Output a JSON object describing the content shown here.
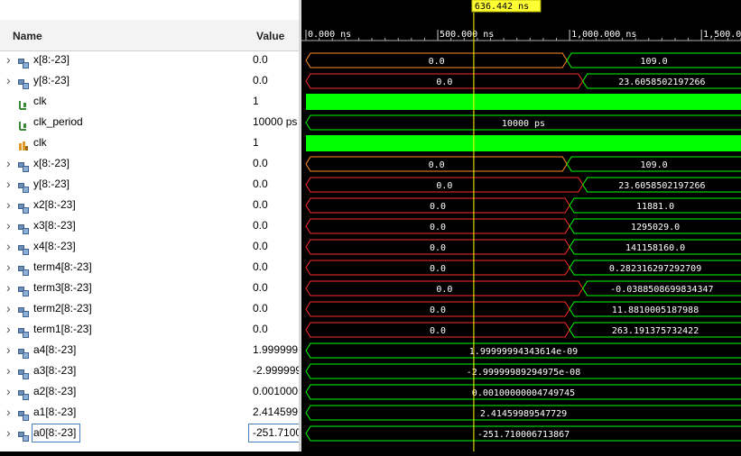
{
  "header": {
    "name_label": "Name",
    "value_label": "Value"
  },
  "cursor": {
    "label": "636.442 ns",
    "time_ns": 636.442
  },
  "timeline": {
    "visible_range_ns": [
      0,
      1650
    ],
    "ticks": [
      {
        "t": 0,
        "label": "0.000 ns"
      },
      {
        "t": 500,
        "label": "500.000 ns"
      },
      {
        "t": 1000,
        "label": "1,000.000 ns"
      },
      {
        "t": 1500,
        "label": "1,500.000 ns"
      }
    ]
  },
  "colors": {
    "clock": "#00ff00",
    "bus_initial": "#ff6a00",
    "bus_changed": "#00ff00",
    "bus_red": "#ff2a2a",
    "cursor": "#ffff00"
  },
  "signals": [
    {
      "name": "x[8:-23]",
      "icon": "bus-icon",
      "expandable": true,
      "value": "0.0",
      "kind": "bus",
      "stroke_before": "#ff8c2a",
      "segments": [
        {
          "t0": 0,
          "t1": 990,
          "text": "0.0"
        },
        {
          "t0": 990,
          "t1": 1650,
          "text": "109.0"
        }
      ]
    },
    {
      "name": "y[8:-23]",
      "icon": "bus-icon",
      "expandable": true,
      "value": "0.0",
      "kind": "bus",
      "stroke_before": "#ff2a2a",
      "segments": [
        {
          "t0": 0,
          "t1": 1050,
          "text": "0.0"
        },
        {
          "t0": 1050,
          "t1": 1650,
          "text": "23.6058502197266"
        }
      ]
    },
    {
      "name": "clk",
      "icon": "clock-bit-icon",
      "expandable": false,
      "value": "1",
      "kind": "clock"
    },
    {
      "name": "clk_period",
      "icon": "clock-bit-icon",
      "expandable": false,
      "value": "10000 ps",
      "kind": "const",
      "segments": [
        {
          "t0": 0,
          "t1": 1650,
          "text": "10000 ps"
        }
      ]
    },
    {
      "name": "clk",
      "icon": "clock-bit-orange-icon",
      "expandable": false,
      "value": "1",
      "kind": "clock"
    },
    {
      "name": "x[8:-23]",
      "icon": "bus-icon",
      "expandable": true,
      "value": "0.0",
      "kind": "bus",
      "stroke_before": "#ff8c2a",
      "segments": [
        {
          "t0": 0,
          "t1": 990,
          "text": "0.0"
        },
        {
          "t0": 990,
          "t1": 1650,
          "text": "109.0"
        }
      ]
    },
    {
      "name": "y[8:-23]",
      "icon": "bus-icon",
      "expandable": true,
      "value": "0.0",
      "kind": "bus",
      "stroke_before": "#ff2a2a",
      "segments": [
        {
          "t0": 0,
          "t1": 1050,
          "text": "0.0"
        },
        {
          "t0": 1050,
          "t1": 1650,
          "text": "23.6058502197266"
        }
      ]
    },
    {
      "name": "x2[8:-23]",
      "icon": "bus-icon",
      "expandable": true,
      "value": "0.0",
      "kind": "bus",
      "stroke_before": "#ff2a2a",
      "segments": [
        {
          "t0": 0,
          "t1": 1000,
          "text": "0.0"
        },
        {
          "t0": 1000,
          "t1": 1650,
          "text": "11881.0"
        }
      ]
    },
    {
      "name": "x3[8:-23]",
      "icon": "bus-icon",
      "expandable": true,
      "value": "0.0",
      "kind": "bus",
      "stroke_before": "#ff2a2a",
      "segments": [
        {
          "t0": 0,
          "t1": 1000,
          "text": "0.0"
        },
        {
          "t0": 1000,
          "t1": 1650,
          "text": "1295029.0"
        }
      ]
    },
    {
      "name": "x4[8:-23]",
      "icon": "bus-icon",
      "expandable": true,
      "value": "0.0",
      "kind": "bus",
      "stroke_before": "#ff2a2a",
      "segments": [
        {
          "t0": 0,
          "t1": 1000,
          "text": "0.0"
        },
        {
          "t0": 1000,
          "t1": 1650,
          "text": "141158160.0"
        }
      ]
    },
    {
      "name": "term4[8:-23]",
      "icon": "bus-icon",
      "expandable": true,
      "value": "0.0",
      "kind": "bus",
      "stroke_before": "#ff2a2a",
      "segments": [
        {
          "t0": 0,
          "t1": 1000,
          "text": "0.0"
        },
        {
          "t0": 1000,
          "t1": 1650,
          "text": "0.282316297292709"
        }
      ]
    },
    {
      "name": "term3[8:-23]",
      "icon": "bus-icon",
      "expandable": true,
      "value": "0.0",
      "kind": "bus",
      "stroke_before": "#ff2a2a",
      "segments": [
        {
          "t0": 0,
          "t1": 1050,
          "text": "0.0"
        },
        {
          "t0": 1050,
          "t1": 1650,
          "text": "-0.0388508699834347"
        }
      ]
    },
    {
      "name": "term2[8:-23]",
      "icon": "bus-icon",
      "expandable": true,
      "value": "0.0",
      "kind": "bus",
      "stroke_before": "#ff2a2a",
      "segments": [
        {
          "t0": 0,
          "t1": 1000,
          "text": "0.0"
        },
        {
          "t0": 1000,
          "t1": 1650,
          "text": "11.8810005187988"
        }
      ]
    },
    {
      "name": "term1[8:-23]",
      "icon": "bus-icon",
      "expandable": true,
      "value": "0.0",
      "kind": "bus",
      "stroke_before": "#ff2a2a",
      "segments": [
        {
          "t0": 0,
          "t1": 1000,
          "text": "0.0"
        },
        {
          "t0": 1000,
          "t1": 1650,
          "text": "263.191375732422"
        }
      ]
    },
    {
      "name": "a4[8:-23]",
      "icon": "bus-icon",
      "expandable": true,
      "value": "1.999999",
      "kind": "const",
      "segments": [
        {
          "t0": 0,
          "t1": 1650,
          "text": "1.99999994343614e-09"
        }
      ]
    },
    {
      "name": "a3[8:-23]",
      "icon": "bus-icon",
      "expandable": true,
      "value": "-2.999999",
      "kind": "const",
      "segments": [
        {
          "t0": 0,
          "t1": 1650,
          "text": "-2.99999989294975e-08"
        }
      ]
    },
    {
      "name": "a2[8:-23]",
      "icon": "bus-icon",
      "expandable": true,
      "value": "0.001000",
      "kind": "const",
      "segments": [
        {
          "t0": 0,
          "t1": 1650,
          "text": "0.00100000004749745"
        }
      ]
    },
    {
      "name": "a1[8:-23]",
      "icon": "bus-icon",
      "expandable": true,
      "value": "2.414599",
      "kind": "const",
      "segments": [
        {
          "t0": 0,
          "t1": 1650,
          "text": "2.41459989547729"
        }
      ]
    },
    {
      "name": "a0[8:-23]",
      "icon": "bus-icon",
      "expandable": true,
      "value": "-251.7100",
      "kind": "const",
      "selected": true,
      "segments": [
        {
          "t0": 0,
          "t1": 1650,
          "text": "-251.710006713867"
        }
      ]
    }
  ]
}
